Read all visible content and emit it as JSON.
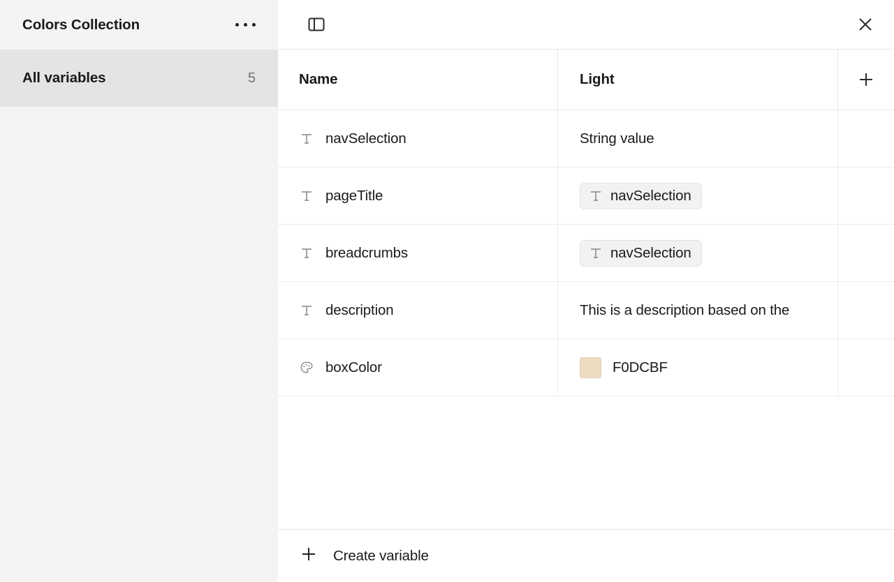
{
  "sidebar": {
    "title": "Colors Collection",
    "menu_icon": "kebab-menu-icon",
    "items": [
      {
        "label": "All variables",
        "count": "5",
        "active": true
      }
    ]
  },
  "header": {
    "panel_toggle_icon": "sidebar-panel-toggle-icon",
    "close_icon": "close-icon"
  },
  "table": {
    "columns": [
      {
        "key": "name",
        "label": "Name"
      },
      {
        "key": "light",
        "label": "Light"
      }
    ],
    "add_mode_icon": "plus-icon",
    "rows": [
      {
        "type_icon": "string-type-icon",
        "name": "navSelection",
        "value_kind": "text",
        "value": "String value"
      },
      {
        "type_icon": "string-type-icon",
        "name": "pageTitle",
        "value_kind": "alias",
        "value": "navSelection",
        "alias_icon": "string-type-icon"
      },
      {
        "type_icon": "string-type-icon",
        "name": "breadcrumbs",
        "value_kind": "alias",
        "value": "navSelection",
        "alias_icon": "string-type-icon"
      },
      {
        "type_icon": "string-type-icon",
        "name": "description",
        "value_kind": "text",
        "value": "This is a description based on the"
      },
      {
        "type_icon": "color-palette-icon",
        "name": "boxColor",
        "value_kind": "color",
        "value": "F0DCBF",
        "swatch_color": "#ecdcc2"
      }
    ]
  },
  "footer": {
    "create_icon": "plus-icon",
    "create_label": "Create variable"
  },
  "colors": {
    "sidebar_bg": "#f4f4f4",
    "sidebar_active_bg": "#e4e4e4",
    "panel_bg": "#ffffff",
    "divider": "#e8e8e8",
    "text": "#1a1a1a",
    "muted_text": "#757575",
    "chip_bg": "#f2f2f2",
    "swatch": "#ecdcc2"
  }
}
